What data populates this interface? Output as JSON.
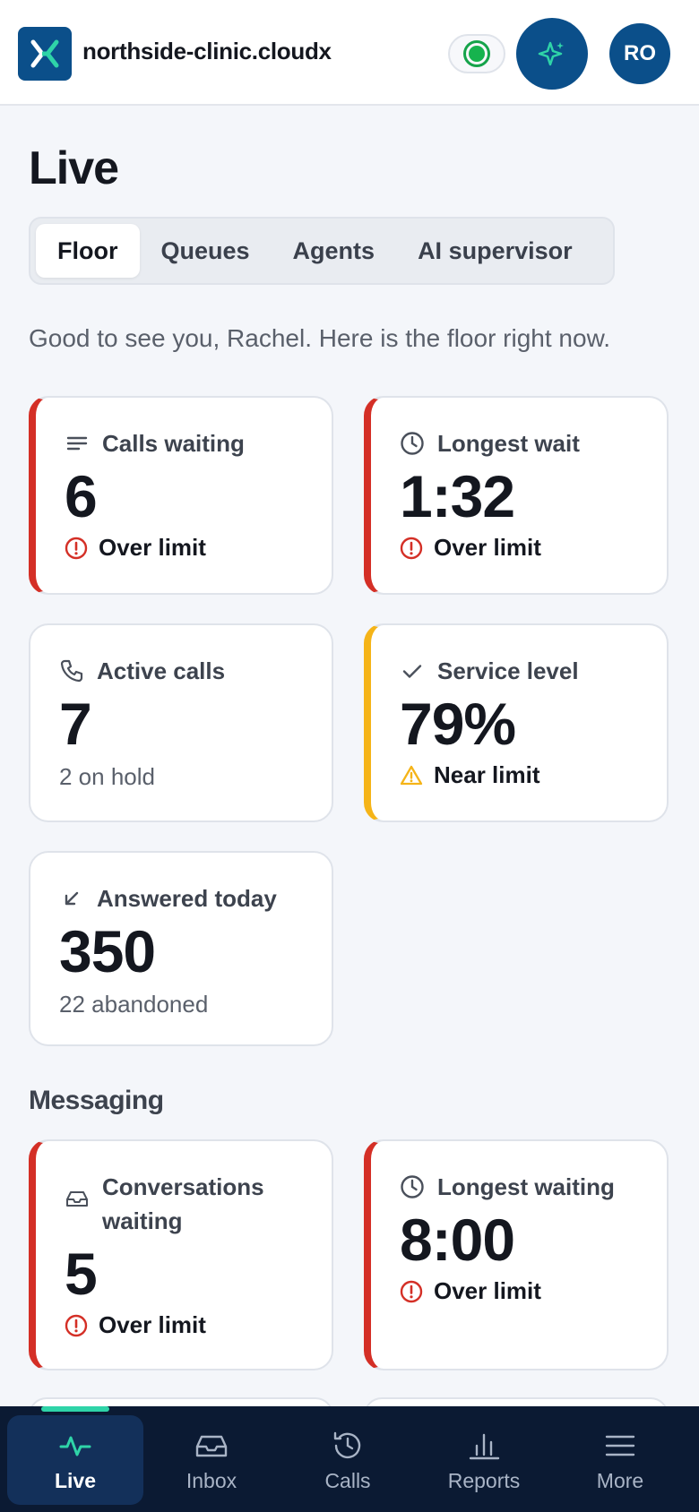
{
  "header": {
    "brand": "northside-clinic.cloudx",
    "avatar_initials": "RO",
    "brand_color": "#0b4f8a",
    "status_color": "#16b34e"
  },
  "page": {
    "title": "Live",
    "tabs": [
      {
        "label": "Floor",
        "active": true
      },
      {
        "label": "Queues",
        "active": false
      },
      {
        "label": "Agents",
        "active": false
      },
      {
        "label": "AI supervisor",
        "active": false
      }
    ],
    "greeting": "Good to see you, Rachel. Here is the floor right now."
  },
  "calls": {
    "calls_waiting": {
      "label": "Calls waiting",
      "value": "6",
      "status": "Over limit",
      "icon": "list-icon"
    },
    "longest_wait": {
      "label": "Longest wait",
      "value": "1:32",
      "status": "Over limit",
      "icon": "clock-icon"
    },
    "active_calls": {
      "label": "Active calls",
      "value": "7",
      "sub": "2 on hold",
      "icon": "phone-icon"
    },
    "service_level": {
      "label": "Service level",
      "value": "79%",
      "status": "Near limit",
      "icon": "check-icon"
    },
    "answered_today": {
      "label": "Answered today",
      "value": "350",
      "sub": "22 abandoned",
      "icon": "arrow-down-left-icon"
    }
  },
  "messaging": {
    "title": "Messaging",
    "conversations_waiting": {
      "label": "Conversations waiting",
      "value": "5",
      "status": "Over limit",
      "icon": "inbox-icon"
    },
    "longest_waiting": {
      "label": "Longest waiting",
      "value": "8:00",
      "status": "Over limit",
      "icon": "clock-icon"
    }
  },
  "status_colors": {
    "over": "#d42f26",
    "near": "#f5b418"
  },
  "bottom_nav": [
    {
      "label": "Live",
      "icon": "activity-icon",
      "active": true
    },
    {
      "label": "Inbox",
      "icon": "inbox-icon",
      "active": false
    },
    {
      "label": "Calls",
      "icon": "history-icon",
      "active": false
    },
    {
      "label": "Reports",
      "icon": "bar-chart-icon",
      "active": false
    },
    {
      "label": "More",
      "icon": "menu-icon",
      "active": false
    }
  ]
}
